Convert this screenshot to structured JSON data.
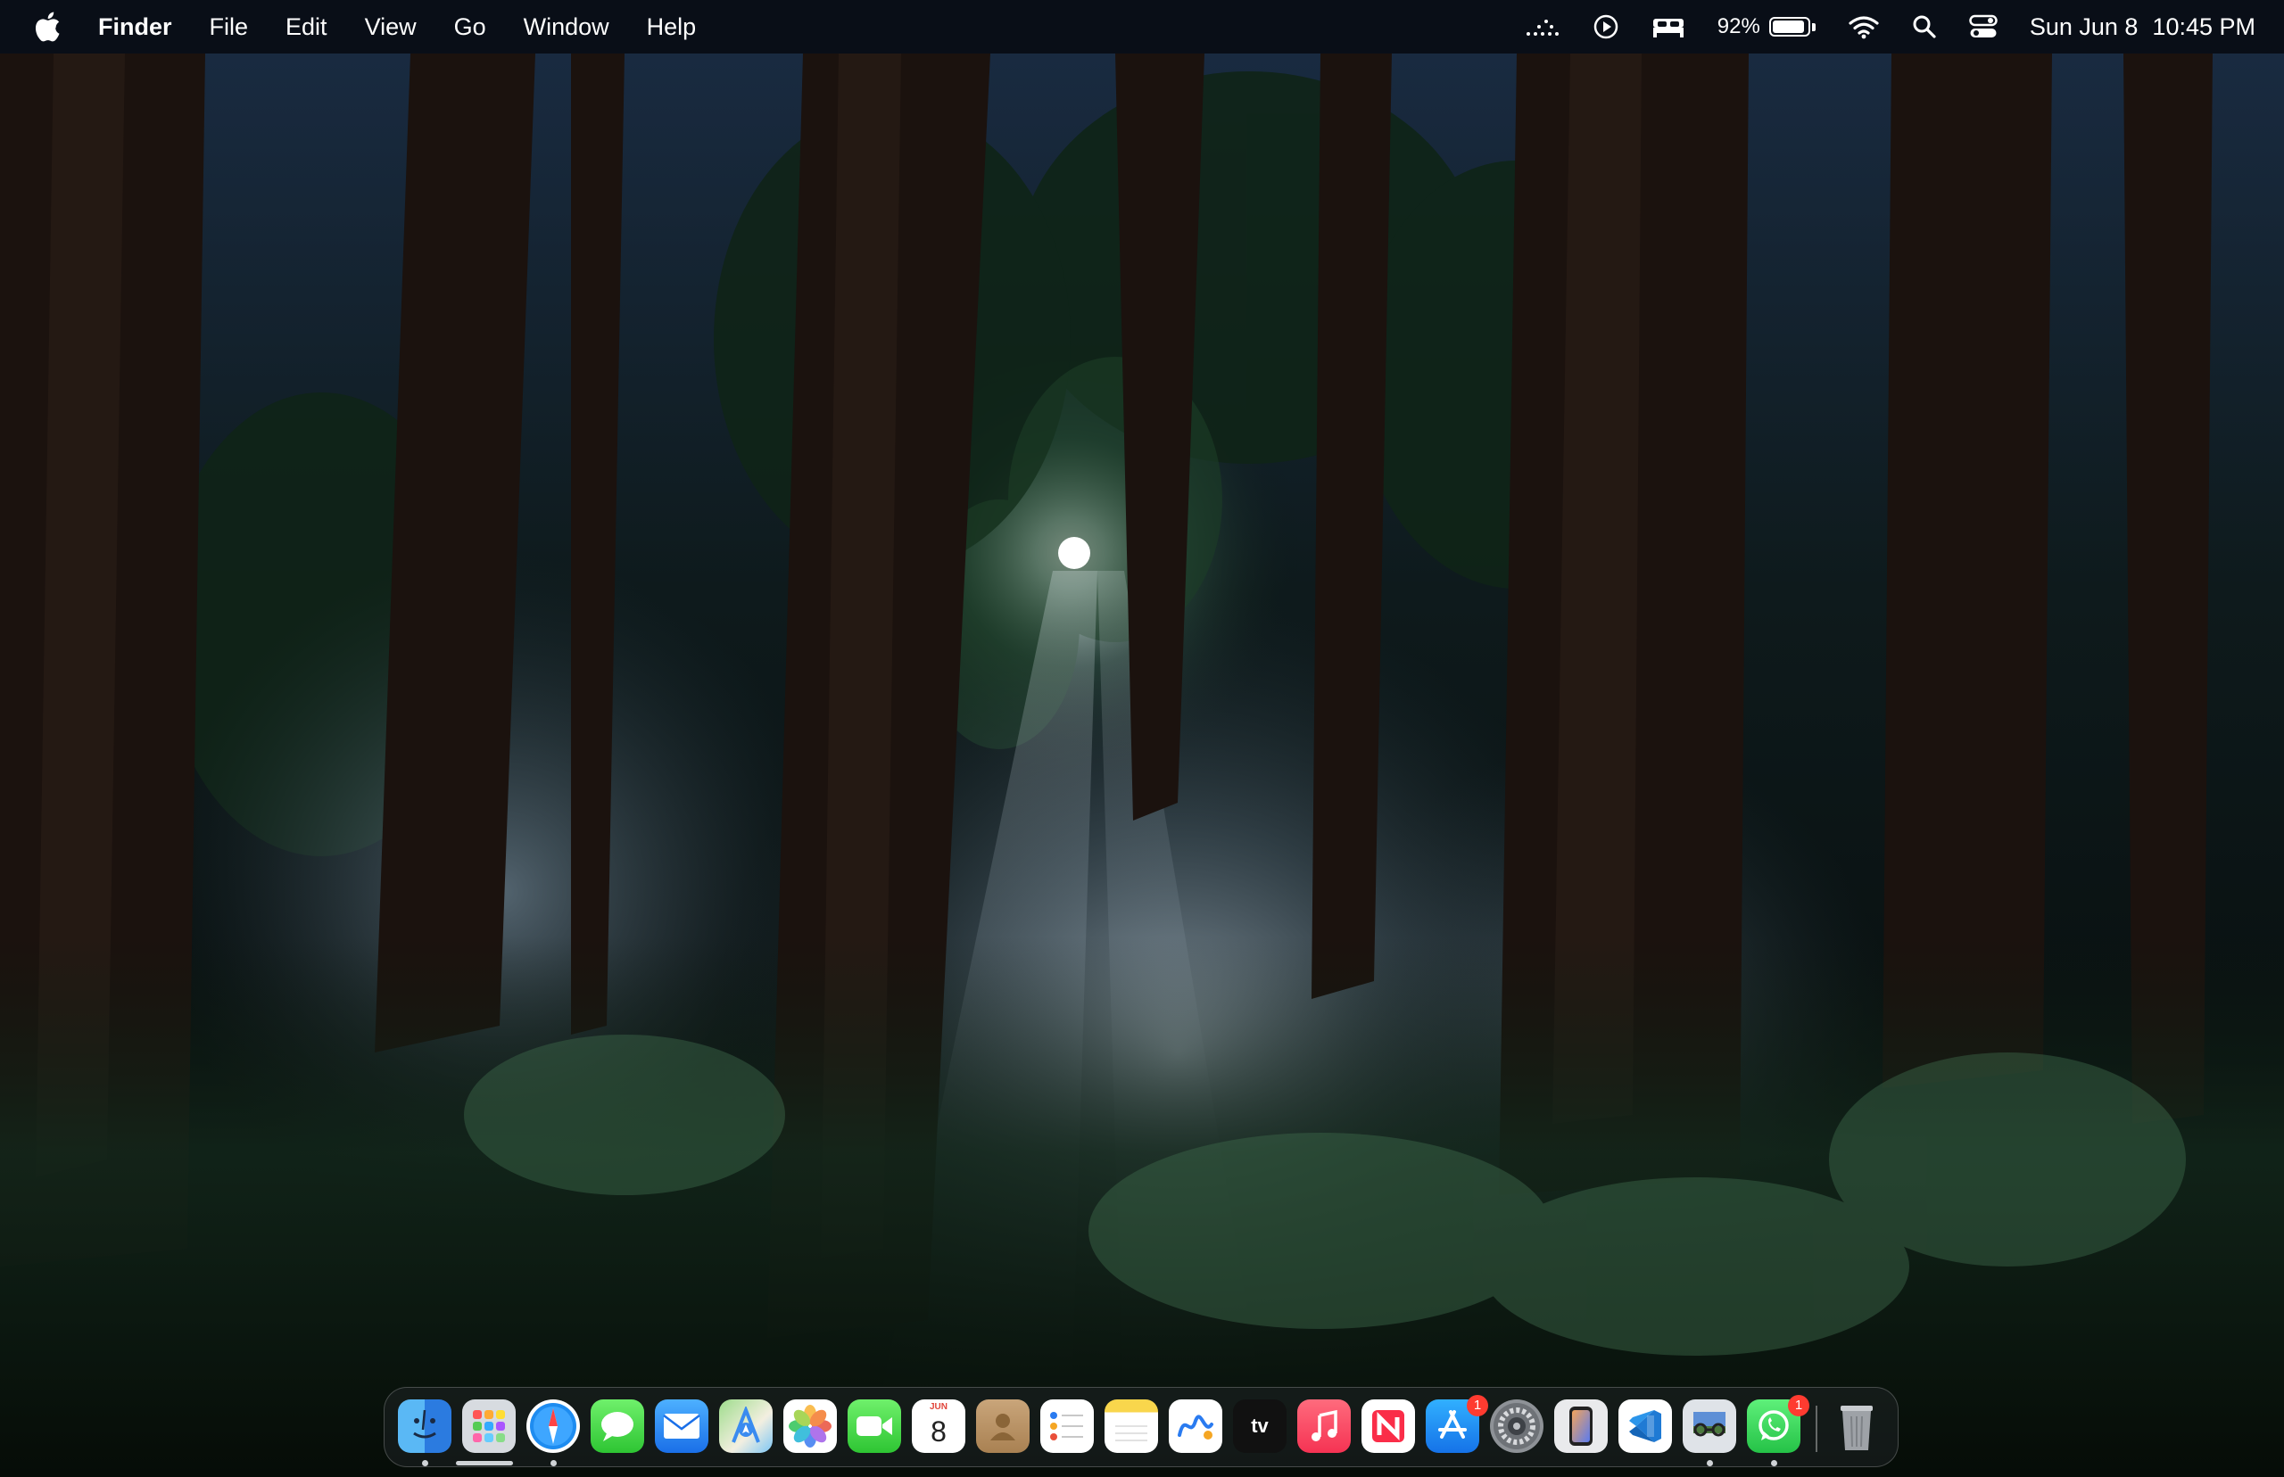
{
  "menubar": {
    "app_name": "Finder",
    "menus": [
      "File",
      "Edit",
      "View",
      "Go",
      "Window",
      "Help"
    ],
    "battery_percent": "92%",
    "battery_level": 0.92,
    "date": "Sun Jun 8",
    "time": "10:45 PM",
    "status_icons": [
      "sync-dots-icon",
      "play-circle-icon",
      "sleep-bed-icon",
      "battery-icon",
      "wifi-icon",
      "spotlight-search-icon",
      "control-center-icon"
    ]
  },
  "dock": {
    "apps": [
      {
        "name": "Finder",
        "icon": "finder-icon",
        "running": true
      },
      {
        "name": "Launchpad",
        "icon": "launchpad-icon"
      },
      {
        "name": "Safari",
        "icon": "safari-icon",
        "running": true
      },
      {
        "name": "Messages",
        "icon": "messages-icon"
      },
      {
        "name": "Mail",
        "icon": "mail-icon"
      },
      {
        "name": "Maps",
        "icon": "maps-icon"
      },
      {
        "name": "Photos",
        "icon": "photos-icon"
      },
      {
        "name": "FaceTime",
        "icon": "facetime-icon"
      },
      {
        "name": "Calendar",
        "icon": "calendar-icon",
        "month": "JUN",
        "day": "8"
      },
      {
        "name": "Contacts",
        "icon": "contacts-icon"
      },
      {
        "name": "Reminders",
        "icon": "reminders-icon"
      },
      {
        "name": "Notes",
        "icon": "notes-icon"
      },
      {
        "name": "Freeform",
        "icon": "freeform-icon"
      },
      {
        "name": "TV",
        "icon": "apple-tv-icon",
        "label": "tv"
      },
      {
        "name": "Music",
        "icon": "music-icon"
      },
      {
        "name": "News",
        "icon": "news-icon"
      },
      {
        "name": "App Store",
        "icon": "app-store-icon",
        "badge": "1"
      },
      {
        "name": "System Settings",
        "icon": "system-settings-icon"
      },
      {
        "name": "iPhone Mirroring",
        "icon": "iphone-mirroring-icon"
      },
      {
        "name": "Visual Studio Code",
        "icon": "vscode-icon"
      },
      {
        "name": "Preview",
        "icon": "preview-icon",
        "running": true
      },
      {
        "name": "WhatsApp",
        "icon": "whatsapp-icon",
        "badge": "1",
        "running": true
      },
      {
        "name": "Trash",
        "icon": "trash-icon"
      }
    ]
  },
  "colors": {
    "menubar_bg": "#080c14",
    "badge_red": "#ff3b30",
    "sky_glow": "#dfeaf0"
  }
}
